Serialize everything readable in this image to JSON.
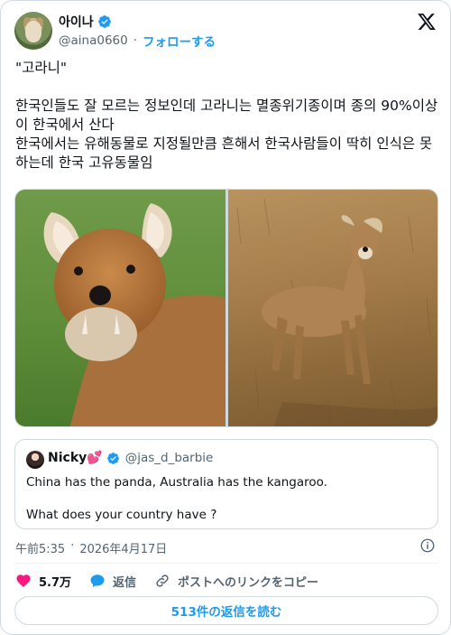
{
  "author": {
    "display_name": "아이나",
    "handle": "@aina0660",
    "separator": "·",
    "follow_label": "フォローする"
  },
  "tweet": {
    "text": "\"고라니\"\n\n한국인들도 잘 모르는 정보인데 고라니는 멸종위기종이며 종의 90%이상이 한국에서 산다\n한국에서는 유해동물로 지정될만큼 흔해서 한국사람들이 딱히 인식은 못하는데 한국 고유동물임"
  },
  "quote": {
    "display_name": "Nicky💕",
    "handle": "@jas_d_barbie",
    "text": "China has the panda, Australia has the kangaroo.\n\nWhat does your country have ?"
  },
  "meta": {
    "time": "午前5:35",
    "separator": "·",
    "date": "2026年4月17日"
  },
  "actions": {
    "like_count": "5.7万",
    "reply_label": "返信",
    "copy_link_label": "ポストへのリンクをコピー"
  },
  "read_replies_label": "513件の返信を読む",
  "colors": {
    "accent": "#1d9bf0",
    "like": "#f91880",
    "text": "#0f1419",
    "muted": "#536471",
    "border": "#cfd9de"
  },
  "icons": [
    "verified-badge-icon",
    "x-logo-icon",
    "info-icon",
    "heart-icon",
    "reply-bubble-icon",
    "link-icon"
  ]
}
